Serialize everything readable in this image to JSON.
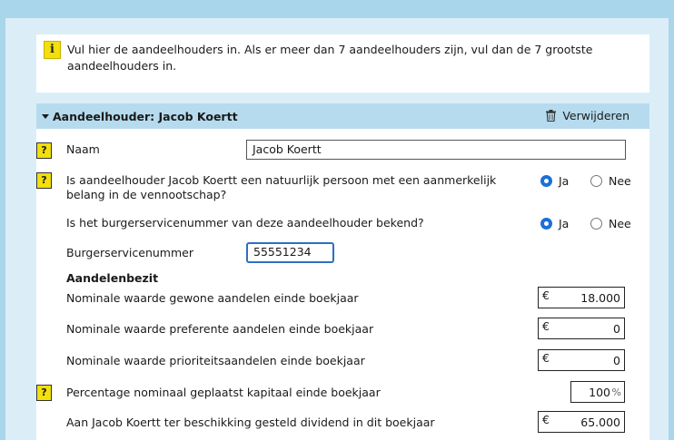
{
  "info": {
    "icon": "info-icon",
    "icon_glyph": "i",
    "text": "Vul hier de aandeelhouders in. Als er meer dan 7 aandeelhouders zijn, vul dan de 7 grootste aandeelhouders in."
  },
  "section": {
    "title": "Aandeelhouder: Jacob Koertt",
    "remove_label": "Verwijderen"
  },
  "help_glyph": "?",
  "fields": {
    "naam": {
      "label": "Naam",
      "value": "Jacob Koertt"
    },
    "natuurlijk": {
      "label": "Is aandeelhouder Jacob Koertt een natuurlijk persoon met een aanmerkelijk belang in de vennootschap?",
      "yes": "Ja",
      "no": "Nee",
      "selected": "Ja"
    },
    "bsn_bekend": {
      "label": "Is het burgerservicenummer van deze aandeelhouder bekend?",
      "yes": "Ja",
      "no": "Nee",
      "selected": "Ja"
    },
    "bsn": {
      "label": "Burgerservicenummer",
      "value": "55551234"
    },
    "aandelenbezit_heading": "Aandelenbezit",
    "gewone": {
      "label": "Nominale waarde gewone aandelen einde boekjaar",
      "currency": "€",
      "value": "18.000"
    },
    "preferente": {
      "label": "Nominale waarde preferente aandelen einde boekjaar",
      "currency": "€",
      "value": "0"
    },
    "prioriteit": {
      "label": "Nominale waarde prioriteitsaandelen einde boekjaar",
      "currency": "€",
      "value": "0"
    },
    "percentage": {
      "label": "Percentage nominaal geplaatst kapitaal einde boekjaar",
      "value": "100",
      "unit": "%"
    },
    "dividend": {
      "label": "Aan Jacob Koertt ter beschikking gesteld dividend in dit boekjaar",
      "currency": "€",
      "value": "65.000"
    }
  }
}
